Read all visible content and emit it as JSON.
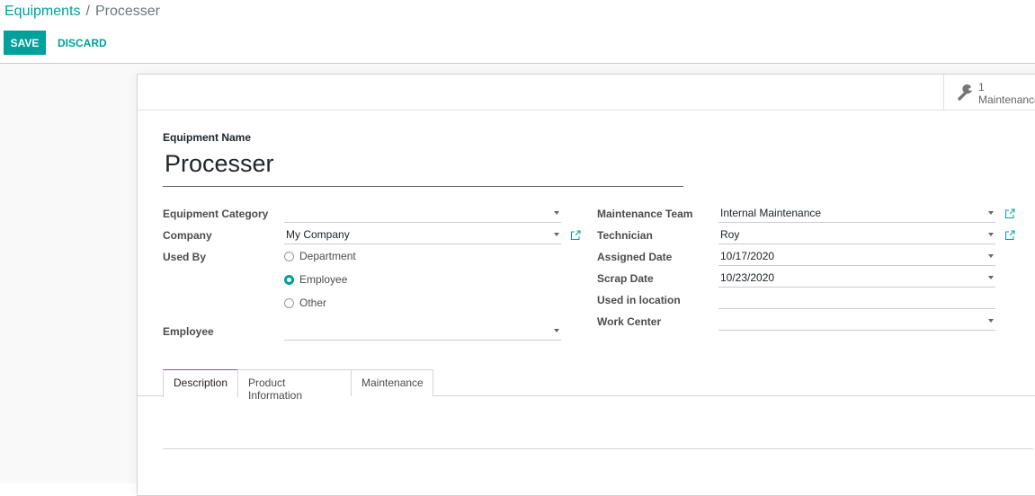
{
  "breadcrumb": {
    "parent": "Equipments",
    "separator": "/",
    "current": "Processer"
  },
  "toolbar": {
    "save_label": "SAVE",
    "discard_label": "DISCARD"
  },
  "stat_button": {
    "count": "1",
    "label": "Maintenance",
    "icon": "wrench-icon"
  },
  "equipment": {
    "name_label": "Equipment Name",
    "name_value": "Processer"
  },
  "left_fields": {
    "category": {
      "label": "Equipment Category",
      "value": ""
    },
    "company": {
      "label": "Company",
      "value": "My Company"
    },
    "used_by": {
      "label": "Used By",
      "options": [
        {
          "label": "Department",
          "checked": false
        },
        {
          "label": "Employee",
          "checked": true
        },
        {
          "label": "Other",
          "checked": false
        }
      ]
    },
    "employee": {
      "label": "Employee",
      "value": ""
    }
  },
  "right_fields": {
    "team": {
      "label": "Maintenance Team",
      "value": "Internal Maintenance"
    },
    "technician": {
      "label": "Technician",
      "value": "Roy"
    },
    "assigned_date": {
      "label": "Assigned Date",
      "value": "10/17/2020"
    },
    "scrap_date": {
      "label": "Scrap Date",
      "value": "10/23/2020"
    },
    "location": {
      "label": "Used in location",
      "value": ""
    },
    "work_center": {
      "label": "Work Center",
      "value": ""
    }
  },
  "tabs": [
    {
      "label": "Description",
      "active": true
    },
    {
      "label": "Product Information",
      "active": false
    },
    {
      "label": "Maintenance",
      "active": false
    }
  ],
  "colors": {
    "primary": "#00a09d",
    "active_tab_border": "#875a7b"
  }
}
